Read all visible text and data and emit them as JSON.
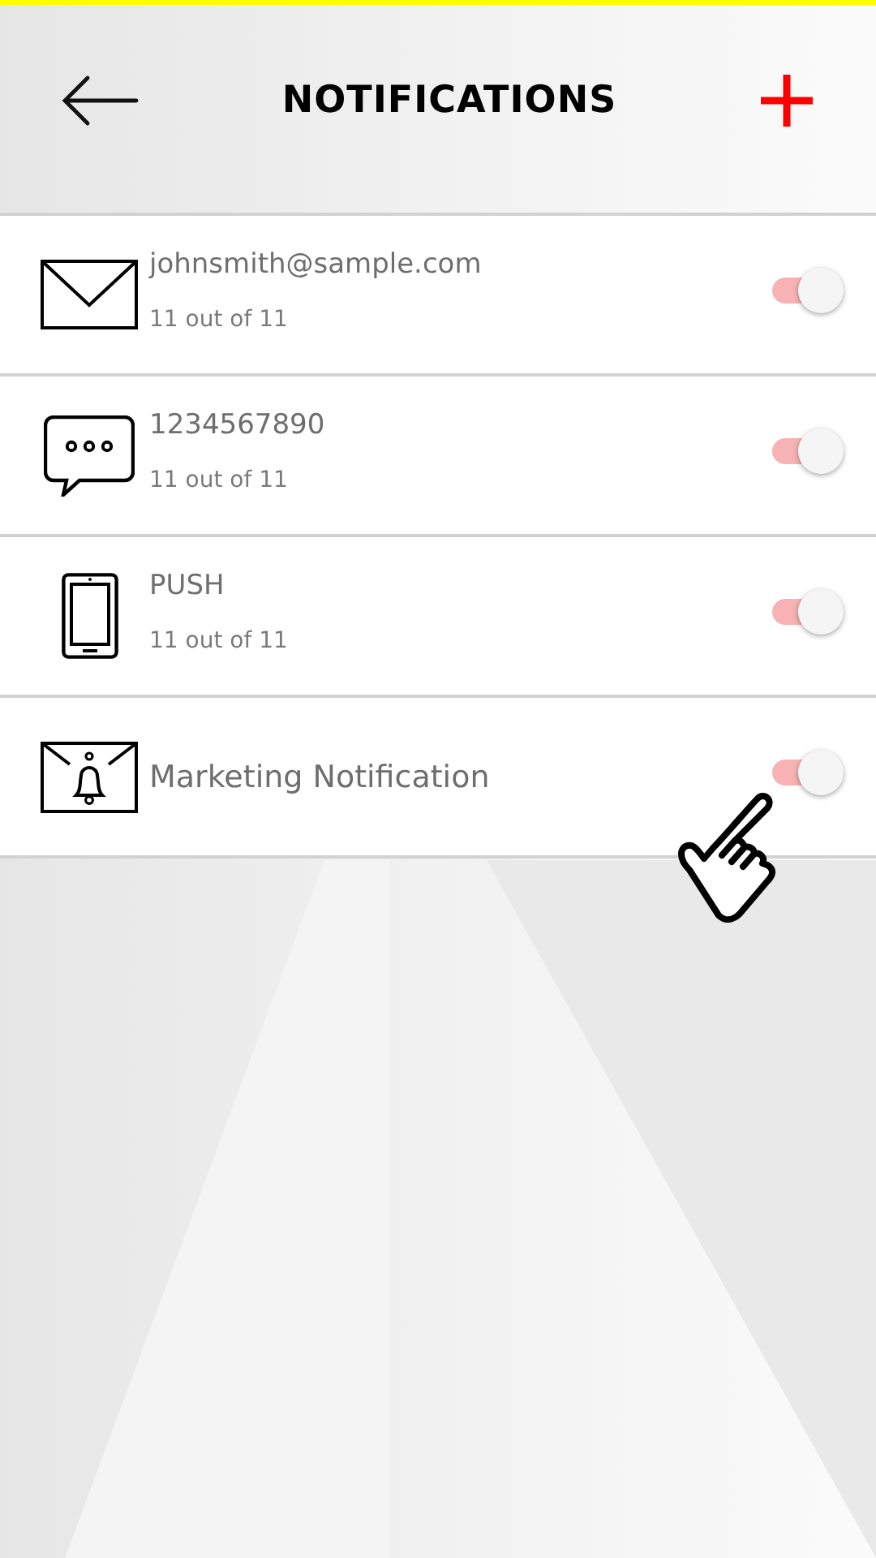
{
  "header": {
    "title": "NOTIFICATIONS"
  },
  "channels": [
    {
      "kind": "email",
      "name": "johnsmith@sample.com",
      "count": "11 out of 11",
      "on": true
    },
    {
      "kind": "sms",
      "name": "1234567890",
      "count": "11 out of 11",
      "on": true
    },
    {
      "kind": "push",
      "name": "PUSH",
      "count": "11 out of 11",
      "on": true
    },
    {
      "kind": "marketing",
      "name": "Marketing Notification",
      "on": true
    }
  ]
}
